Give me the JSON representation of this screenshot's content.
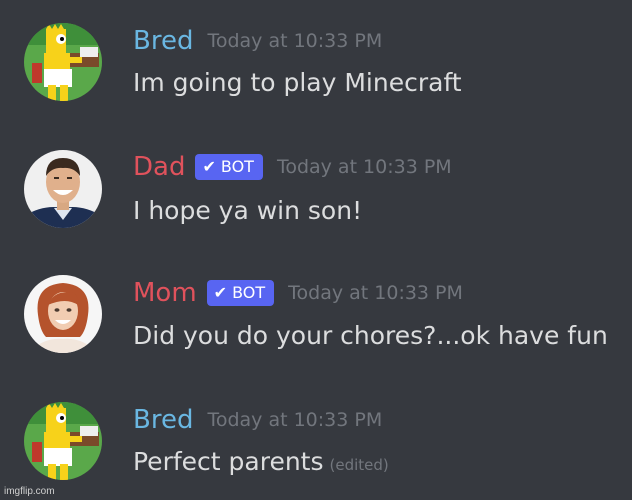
{
  "colors": {
    "background": "#36393f",
    "bred": "#6ab7e2",
    "dad": "#e0525c",
    "mom": "#e0525c",
    "bot_badge": "#5865f2",
    "timestamp": "#72767d",
    "message_text": "#dcddde"
  },
  "messages": [
    {
      "author": "Bred",
      "timestamp": "Today at 10:33 PM",
      "text": "Im going to play Minecraft",
      "avatar_icon": "bart-simpson-avatar"
    },
    {
      "author": "Dad",
      "badge": "BOT",
      "timestamp": "Today at 10:33 PM",
      "text": "I hope ya win son!",
      "avatar_icon": "smiling-man-avatar"
    },
    {
      "author": "Mom",
      "badge": "BOT",
      "timestamp": "Today at 10:33 PM",
      "text": "Did you do your chores?...ok have fun",
      "avatar_icon": "smiling-woman-avatar"
    },
    {
      "author": "Bred",
      "timestamp": "Today at 10:33 PM",
      "text": "Perfect parents",
      "edited": "(edited)",
      "avatar_icon": "bart-simpson-avatar"
    }
  ],
  "watermark": "imgflip.com"
}
